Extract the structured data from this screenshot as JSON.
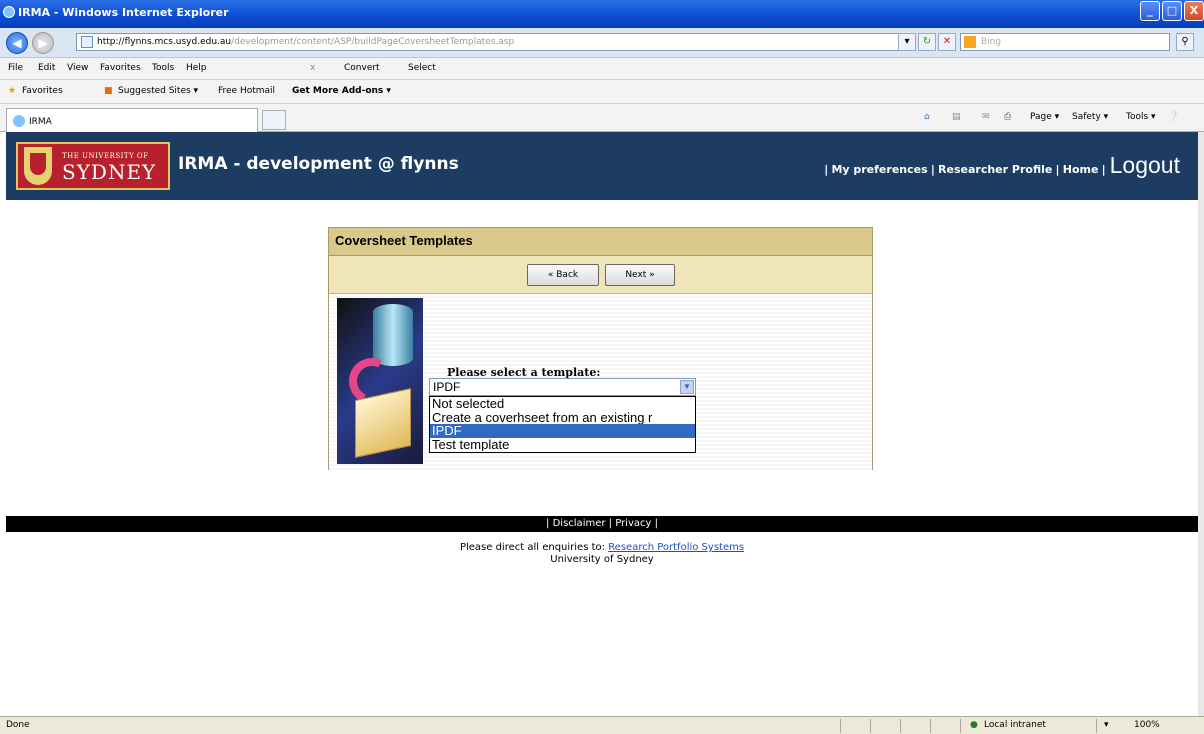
{
  "window": {
    "title": "IRMA - Windows Internet Explorer",
    "min": "_",
    "max": "□",
    "close": "X"
  },
  "address": {
    "host": "http://flynns.mcs.usyd.edu.au",
    "path": "/development/content/ASP/buildPageCoversheetTemplates.asp",
    "search_placeholder": "Bing"
  },
  "menu": {
    "items": [
      "File",
      "Edit",
      "View",
      "Favorites",
      "Tools",
      "Help"
    ],
    "convert": "Convert",
    "select": "Select",
    "x": "x"
  },
  "favorites": {
    "label": "Favorites",
    "items": [
      "Suggested Sites ▾",
      "Free Hotmail",
      "Get More Add-ons ▾"
    ]
  },
  "tab": {
    "label": "IRMA"
  },
  "commandbar": {
    "items": [
      "Page ▾",
      "Safety ▾",
      "Tools ▾"
    ]
  },
  "banner": {
    "uni_small": "THE UNIVERSITY OF",
    "uni_big": "SYDNEY",
    "app_title": "IRMA - development @ flynns",
    "link_sep": "|",
    "links": [
      "My preferences",
      "Researcher Profile",
      "Home"
    ],
    "logout": "Logout"
  },
  "panel": {
    "title": "Coversheet Templates",
    "back": "« Back",
    "next": "Next »",
    "prompt": "Please select a template:",
    "selected": "IPDF",
    "options": [
      "Not selected",
      "Create a coverhseet from an existing r",
      "IPDF",
      "Test template"
    ],
    "selected_index": 2
  },
  "footer": {
    "links": "| Disclaimer | Privacy |",
    "enquiries": "Please direct all enquiries to:",
    "enquiries_link": "Research Portfolio Systems",
    "org": "University of Sydney"
  },
  "status": {
    "text": "Done",
    "zone": "Local intranet",
    "zoom": "100%"
  }
}
